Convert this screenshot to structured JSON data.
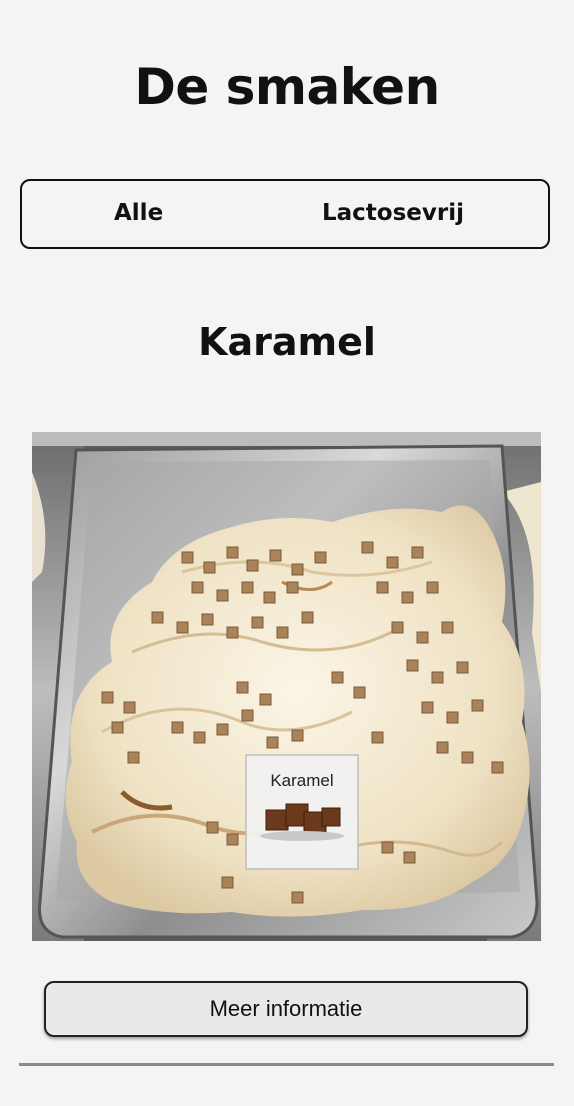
{
  "header": {
    "title": "De smaken"
  },
  "filters": {
    "all_label": "Alle",
    "lactose_free_label": "Lactosevrij"
  },
  "flavor": {
    "name": "Karamel",
    "image_sign_text": "Karamel",
    "more_info_label": "Meer informatie"
  },
  "colors": {
    "background": "#f4f4f4",
    "text": "#111111",
    "button_fill": "#e9e9e9",
    "caramel": "#a9835a",
    "ice_cream": "#f1e6cd"
  }
}
